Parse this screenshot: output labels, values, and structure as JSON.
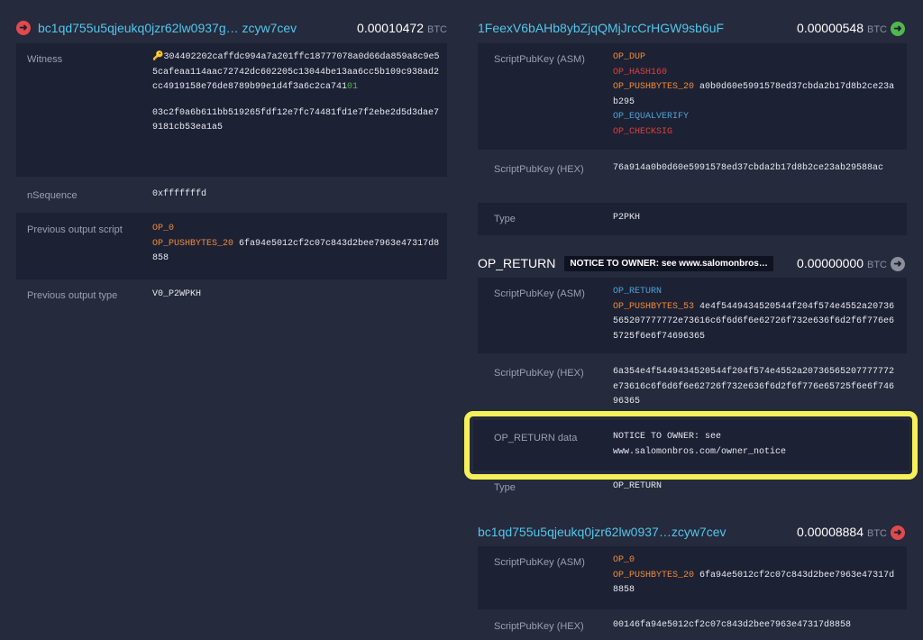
{
  "input": {
    "address": "bc1qd755u5qjeukq0jzr62lw0937g… zcyw7cev",
    "amount": "0.00010472",
    "unit": "BTC",
    "witness": {
      "label": "Witness",
      "line1_main": "304402202caffdc994a7a201ffc18777078a0d66da859a8c9e55cafeaa114aac72742dc602205c13044be13aa6cc5b109c938ad2cc4919158e76de8789b99e1d4f3a6c2ca741",
      "line1_tail": "01",
      "line2": "03c2f0a6b611bb519265fdf12e7fc74481fd1e7f2ebe2d5d3dae79181cb53ea1a5"
    },
    "nsequence": {
      "label": "nSequence",
      "value": "0xfffffffd"
    },
    "prev_script": {
      "label": "Previous output script",
      "op0": "OP_0",
      "op1": "OP_PUSHBYTES_20",
      "data": "6fa94e5012cf2c07c843d2bee7963e47317d8858"
    },
    "prev_type": {
      "label": "Previous output type",
      "value": "V0_P2WPKH"
    }
  },
  "output1": {
    "address": "1FeexV6bAHb8ybZjqQMjJrcCrHGW9sb6uF",
    "amount": "0.00000548",
    "unit": "BTC",
    "asm_label": "ScriptPubKey (ASM)",
    "asm": {
      "op1": "OP_DUP",
      "op2": "OP_HASH160",
      "op3": "OP_PUSHBYTES_20",
      "op3_data": "a0b0d60e5991578ed37cbda2b17d8b2ce23ab295",
      "op4": "OP_EQUALVERIFY",
      "op5": "OP_CHECKSIG"
    },
    "hex_label": "ScriptPubKey (HEX)",
    "hex": "76a914a0b0d60e5991578ed37cbda2b17d8b2ce23ab29588ac",
    "type_label": "Type",
    "type": "P2PKH"
  },
  "output2": {
    "address": "OP_RETURN",
    "tag": "NOTICE TO OWNER: see www.salomonbros…",
    "amount": "0.00000000",
    "unit": "BTC",
    "asm_label": "ScriptPubKey (ASM)",
    "asm": {
      "op1": "OP_RETURN",
      "op2": "OP_PUSHBYTES_53",
      "op2_data": "4e4f5449434520544f204f574e4552a20736565207777772e73616c6f6d6f6e62726f732e636f6d2f6f776e65725f6e6f74696365"
    },
    "hex_label": "ScriptPubKey (HEX)",
    "hex": "6a354e4f5449434520544f204f574e4552a20736565207777772e73616c6f6d6f6e62726f732e636f6d2f6f776e65725f6e6f74696365",
    "data_label": "OP_RETURN data",
    "data_line1": "NOTICE TO OWNER: see",
    "data_line2": "www.salomonbros.com/owner_notice",
    "type_label": "Type",
    "type": "OP_RETURN"
  },
  "output3": {
    "address": "bc1qd755u5qjeukq0jzr62lw0937…zcyw7cev",
    "amount": "0.00008884",
    "unit": "BTC",
    "asm_label": "ScriptPubKey (ASM)",
    "asm": {
      "op1": "OP_0",
      "op2": "OP_PUSHBYTES_20",
      "op2_data": "6fa94e5012cf2c07c843d2bee7963e47317d8858"
    },
    "hex_label": "ScriptPubKey (HEX)",
    "hex": "00146fa94e5012cf2c07c843d2bee7963e47317d8858"
  },
  "colors": {
    "highlight": "#f6f05a",
    "address": "#53c6ec",
    "op_orange": "#f08c3a",
    "op_red": "#d9423f",
    "op_blue": "#4fa3d8"
  },
  "icons": {
    "input": "arrow-circle-red-icon",
    "output1": "arrow-circle-green-icon",
    "output2": "arrow-circle-gray-icon",
    "output3": "arrow-circle-red-icon",
    "witness": "key-icon"
  }
}
